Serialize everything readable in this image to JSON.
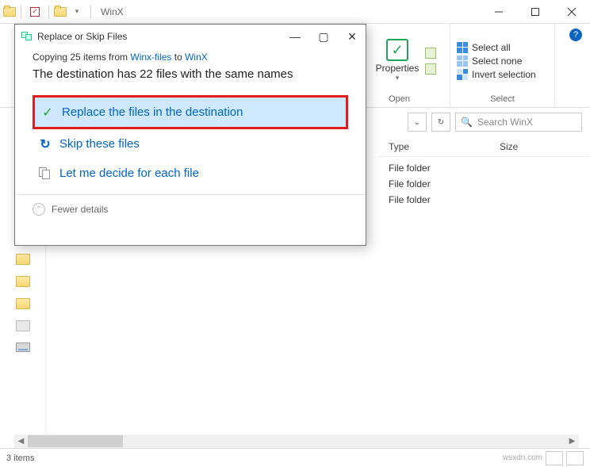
{
  "window": {
    "title": "WinX"
  },
  "ribbon": {
    "properties_label": "Properties",
    "open_group": "Open",
    "select_all": "Select all",
    "select_none": "Select none",
    "invert": "Invert selection",
    "select_group": "Select"
  },
  "search": {
    "placeholder": "Search WinX"
  },
  "columns": {
    "type": "Type",
    "size": "Size"
  },
  "rows": [
    "File folder",
    "File folder",
    "File folder"
  ],
  "status": {
    "count": "3 items",
    "watermark": "wsxdn.com"
  },
  "dialog": {
    "title": "Replace or Skip Files",
    "copying_prefix": "Copying 25 items from ",
    "from": "Winx-files",
    "to_word": " to ",
    "to": "WinX",
    "destination_line": "The destination has 22 files with the same names",
    "replace": "Replace the files in the destination",
    "skip": "Skip these files",
    "decide": "Let me decide for each file",
    "fewer": "Fewer details"
  }
}
